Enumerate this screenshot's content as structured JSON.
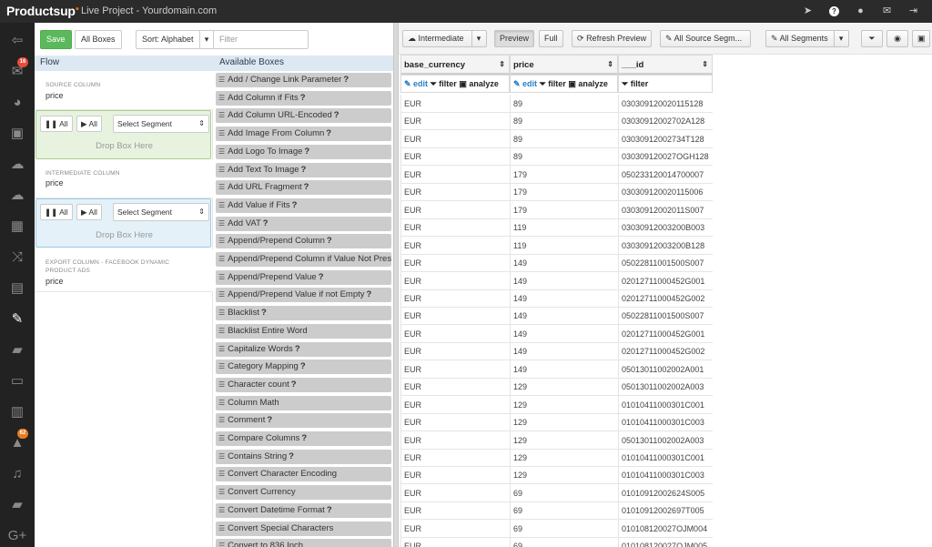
{
  "topbar": {
    "logo": "Productsup",
    "project_title": "Live Project - Yourdomain.com"
  },
  "rail": {
    "badges": {
      "mail": "16",
      "alerts": "62"
    }
  },
  "flow_toolbar": {
    "save_label": "Save",
    "boxes_label": "All Boxes",
    "sort_label": "Sort: Alphabet",
    "filter_placeholder": "Filter"
  },
  "flow_header": {
    "flow": "Flow",
    "available": "Available Boxes"
  },
  "columns": {
    "source": {
      "caption": "SOURCE COLUMN",
      "value": "price"
    },
    "intermediate": {
      "caption": "INTERMEDIATE COLUMN",
      "value": "price"
    },
    "export": {
      "caption": "EXPORT COLUMN - FACEBOOK DYNAMIC PRODUCT ADS",
      "value": "price"
    }
  },
  "drop_zone": {
    "pause_all": "All",
    "play_all": "All",
    "segment": "Select Segment",
    "drop_text": "Drop Box Here"
  },
  "boxes": [
    "Add / Change Link Parameter",
    "Add Column if Fits",
    "Add Column URL-Encoded",
    "Add Image From Column",
    "Add Logo To Image",
    "Add Text To Image",
    "Add URL Fragment",
    "Add Value if Fits",
    "Add VAT",
    "Append/Prepend Column",
    "Append/Prepend Column if Value Not Present",
    "Append/Prepend Value",
    "Append/Prepend Value if not Empty",
    "Blacklist",
    "Blacklist Entire Word",
    "Capitalize Words",
    "Category Mapping",
    "Character count",
    "Column Math",
    "Comment",
    "Compare Columns",
    "Contains String",
    "Convert Character Encoding",
    "Convert Currency",
    "Convert Datetime Format",
    "Convert Special Characters",
    "Convert to 836 Inch"
  ],
  "boxes_help": [
    true,
    true,
    true,
    true,
    true,
    true,
    true,
    true,
    true,
    true,
    false,
    true,
    true,
    true,
    false,
    true,
    true,
    true,
    false,
    true,
    true,
    true,
    false,
    false,
    true,
    false,
    false
  ],
  "preview_toolbar": {
    "stage": "Intermediate",
    "preview": "Preview",
    "full": "Full",
    "refresh": "Refresh Preview",
    "source_segments": "All Source Segm...",
    "segments": "All Segments"
  },
  "table": {
    "headers": [
      "base_currency",
      "price",
      "___id"
    ],
    "controls": {
      "edit": "edit",
      "filter": "filter",
      "analyze": "analyze"
    },
    "rows": [
      [
        "EUR",
        "89",
        "030309120020115128"
      ],
      [
        "EUR",
        "89",
        "03030912002702A128"
      ],
      [
        "EUR",
        "89",
        "03030912002734T128"
      ],
      [
        "EUR",
        "89",
        "030309120027OGH128"
      ],
      [
        "EUR",
        "179",
        "050233120014700007"
      ],
      [
        "EUR",
        "179",
        "030309120020115006"
      ],
      [
        "EUR",
        "179",
        "03030912002011S007"
      ],
      [
        "EUR",
        "119",
        "03030912003200B003"
      ],
      [
        "EUR",
        "119",
        "03030912003200B128"
      ],
      [
        "EUR",
        "149",
        "05022811001500S007"
      ],
      [
        "EUR",
        "149",
        "02012711000452G001"
      ],
      [
        "EUR",
        "149",
        "02012711000452G002"
      ],
      [
        "EUR",
        "149",
        "05022811001500S007"
      ],
      [
        "EUR",
        "149",
        "02012711000452G001"
      ],
      [
        "EUR",
        "149",
        "02012711000452G002"
      ],
      [
        "EUR",
        "149",
        "05013011002002A001"
      ],
      [
        "EUR",
        "129",
        "05013011002002A003"
      ],
      [
        "EUR",
        "129",
        "01010411000301C001"
      ],
      [
        "EUR",
        "129",
        "01010411000301C003"
      ],
      [
        "EUR",
        "129",
        "05013011002002A003"
      ],
      [
        "EUR",
        "129",
        "01010411000301C001"
      ],
      [
        "EUR",
        "129",
        "01010411000301C003"
      ],
      [
        "EUR",
        "69",
        "01010912002624S005"
      ],
      [
        "EUR",
        "69",
        "01010912002697T005"
      ],
      [
        "EUR",
        "69",
        "010108120027OJM004"
      ],
      [
        "EUR",
        "69",
        "010108120027OJM005"
      ]
    ]
  }
}
